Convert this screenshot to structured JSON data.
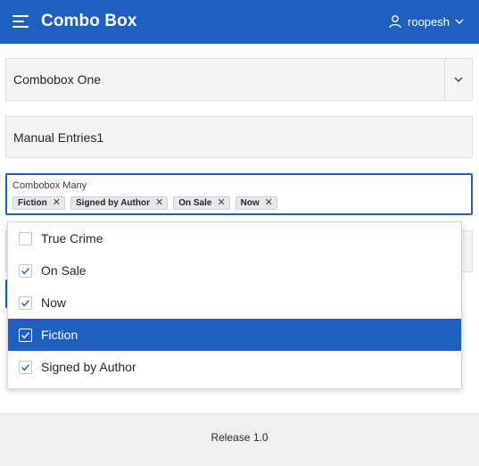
{
  "header": {
    "title": "Combo Box",
    "user_name": "roopesh",
    "background_color": "#1f5fbf",
    "menu_icon": "hamburger-menu-icon",
    "user_icon": "user-icon",
    "user_menu_icon": "chevron-down-icon"
  },
  "combobox_one": {
    "value": "Combobox One",
    "toggle_icon": "chevron-down-icon"
  },
  "manual_entries": {
    "value": "Manual Entries1"
  },
  "combobox_many": {
    "label": "Combobox Many",
    "chips": [
      {
        "label": "Fiction",
        "remove_icon": "close-icon"
      },
      {
        "label": "Signed by Author",
        "remove_icon": "close-icon"
      },
      {
        "label": "On Sale",
        "remove_icon": "close-icon"
      },
      {
        "label": "Now",
        "remove_icon": "close-icon"
      }
    ]
  },
  "dropdown": {
    "options": [
      {
        "label": "True Crime",
        "checked": false,
        "highlighted": false
      },
      {
        "label": "On Sale",
        "checked": true,
        "highlighted": false
      },
      {
        "label": "Now",
        "checked": true,
        "highlighted": false
      },
      {
        "label": "Fiction",
        "checked": true,
        "highlighted": true
      },
      {
        "label": "Signed by Author",
        "checked": true,
        "highlighted": false
      }
    ],
    "highlight_color": "#1f5fbf"
  },
  "footer": {
    "release": "Release 1.0"
  }
}
